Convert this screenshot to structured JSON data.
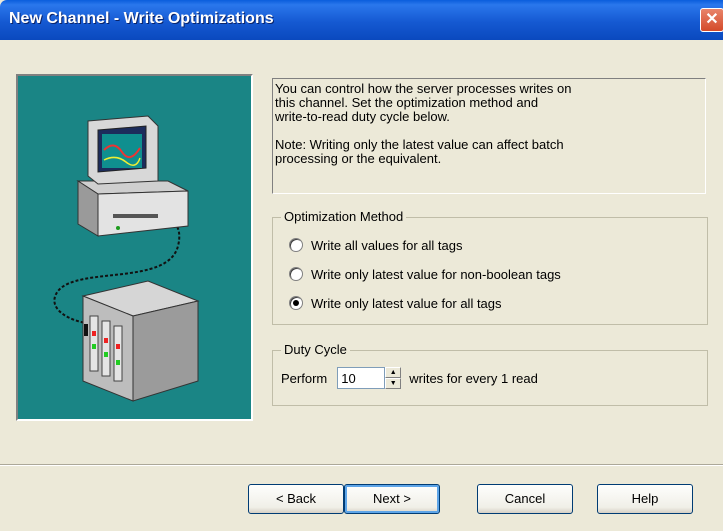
{
  "window": {
    "title": "New Channel - Write Optimizations",
    "close_glyph": "✕"
  },
  "description": {
    "line1": "You can control how the server processes writes on",
    "line2": "this channel.  Set the optimization method and",
    "line3": "write-to-read duty cycle below.",
    "note1": "Note:  Writing only the latest value can affect batch",
    "note2": "processing or the equivalent."
  },
  "optimization": {
    "legend": "Optimization Method",
    "options": [
      {
        "label": "Write all values for all tags",
        "checked": false
      },
      {
        "label": "Write only latest value for non-boolean tags",
        "checked": false
      },
      {
        "label": "Write only latest value for all tags",
        "checked": true
      }
    ]
  },
  "duty_cycle": {
    "legend": "Duty Cycle",
    "prefix": "Perform",
    "value": "10",
    "suffix": "writes for every 1 read",
    "up_glyph": "▲",
    "down_glyph": "▼"
  },
  "buttons": {
    "back": "< Back",
    "next": "Next >",
    "cancel": "Cancel",
    "help": "Help"
  },
  "colors": {
    "titlebar": "#0a5ddc",
    "art_background": "#1a8585",
    "dialog_face": "#ece9d8"
  },
  "icons": [
    "computer-monitor-icon",
    "plc-device-icon",
    "close-icon"
  ]
}
